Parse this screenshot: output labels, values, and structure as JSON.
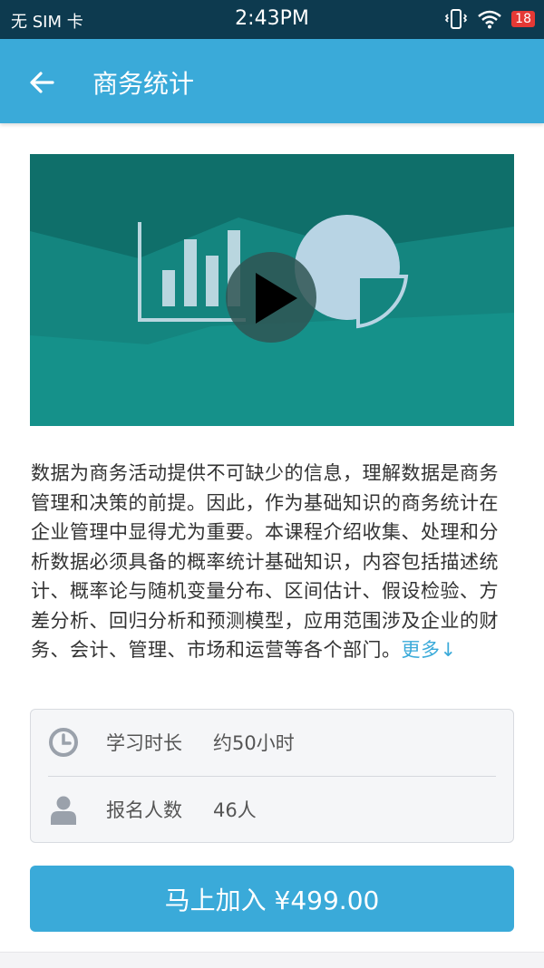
{
  "status_bar": {
    "carrier": "无 SIM 卡",
    "time": "2:43PM",
    "battery": "18"
  },
  "header": {
    "title": "商务统计"
  },
  "course": {
    "description": "数据为商务活动提供不可缺少的信息，理解数据是商务管理和决策的前提。因此，作为基础知识的商务统计在企业管理中显得尤为重要。本课程介绍收集、处理和分析数据必须具备的概率统计基础知识，内容包括描述统计、概率论与随机变量分布、区间估计、假设检验、方差分析、回归分析和预测模型，应用范围涉及企业的财务、会计、管理、市场和运营等各个部门。",
    "more_label": "更多↓"
  },
  "info": {
    "study_time_label": "学习时长",
    "study_time_value": "约50小时",
    "enrolled_label": "报名人数",
    "enrolled_value": "46人"
  },
  "join_button": "马上加入 ¥499.00",
  "colors": {
    "accent": "#3aaad9",
    "status_bar": "#0d3a4f",
    "video_bg": "#14857f"
  }
}
